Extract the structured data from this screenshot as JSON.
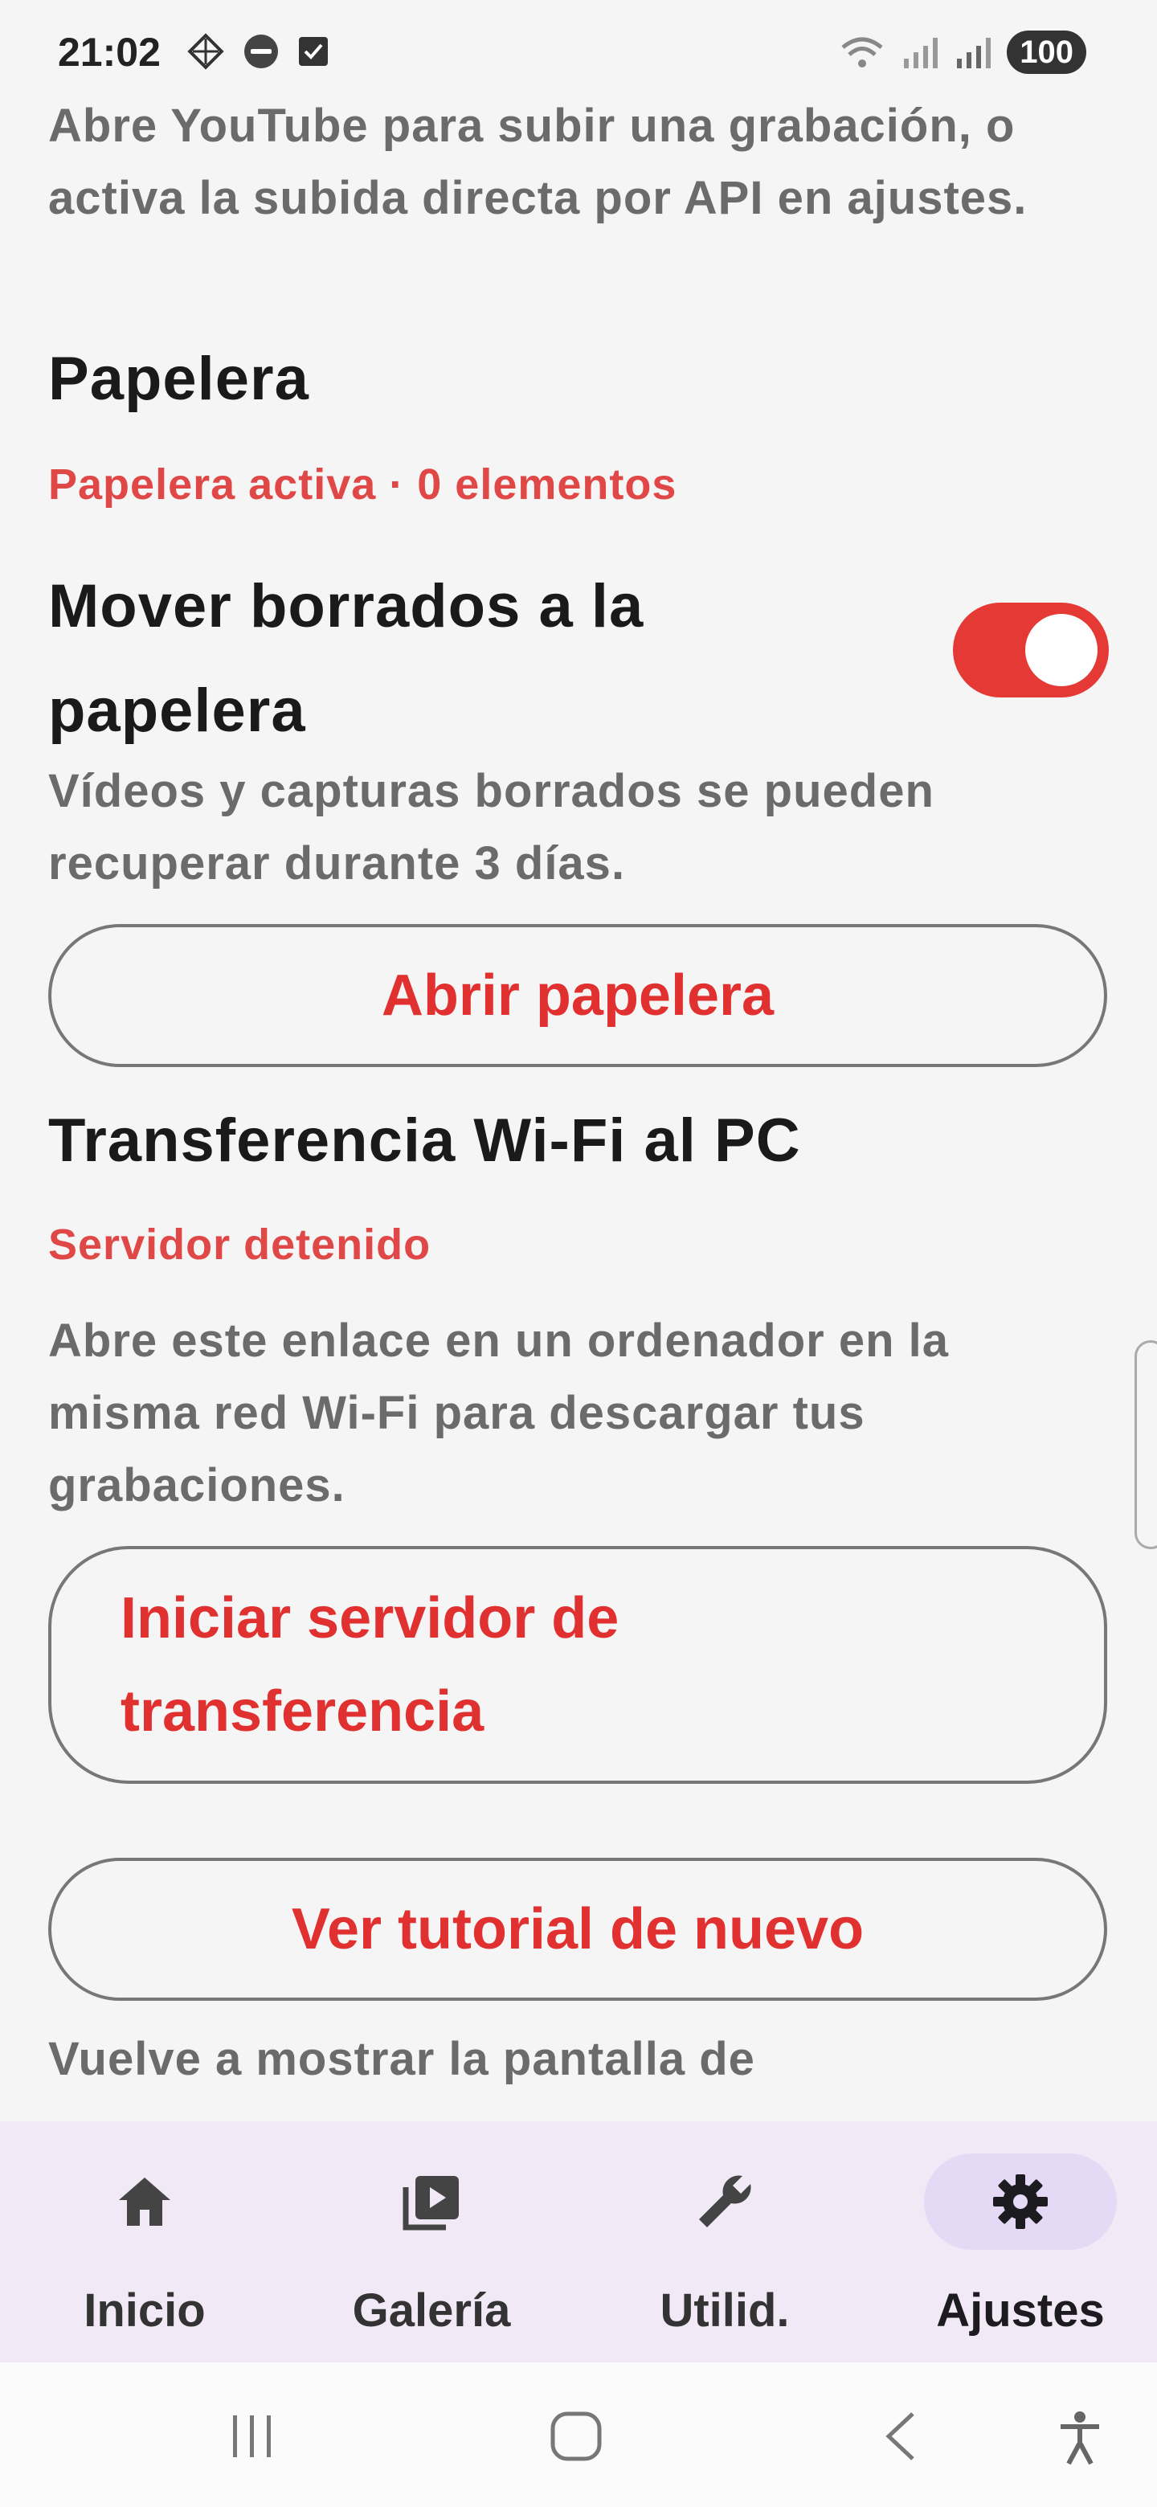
{
  "status_bar": {
    "time": "21:02",
    "battery": "100",
    "left_icons": [
      "grid-diamond-icon",
      "news-icon",
      "check-box-icon"
    ],
    "right_icons": [
      "wifi-icon",
      "signal-icon",
      "signal-icon"
    ]
  },
  "content": {
    "youtube_note": "Abre YouTube para subir una grabación, o activa la subida directa por API en ajustes.",
    "trash": {
      "title": "Papelera",
      "status": "Papelera activa · 0 elementos",
      "move_deleted_label": "Mover borrados a la papelera",
      "toggle_on": true,
      "description": "Vídeos y capturas borrados se pueden recuperar durante 3 días.",
      "open_button": "Abrir papelera"
    },
    "wifi_transfer": {
      "title": "Transferencia Wi-Fi al PC",
      "status": "Servidor detenido",
      "description": "Abre este enlace en un ordenador en la misma red Wi-Fi para descargar tus grabaciones.",
      "start_button": "Iniciar servidor de transferencia"
    },
    "tutorial": {
      "button": "Ver tutorial de nuevo",
      "description_partial": "Vuelve a mostrar la pantalla de"
    }
  },
  "bottom_nav": {
    "items": [
      {
        "label": "Inicio",
        "icon": "home-icon"
      },
      {
        "label": "Galería",
        "icon": "video-library-icon"
      },
      {
        "label": "Utilid.",
        "icon": "wrench-icon"
      },
      {
        "label": "Ajustes",
        "icon": "gear-icon",
        "active": true
      }
    ]
  },
  "colors": {
    "accent": "#e53935",
    "nav_background": "#f1eaf6",
    "nav_active_pill": "#e5d9f6"
  }
}
